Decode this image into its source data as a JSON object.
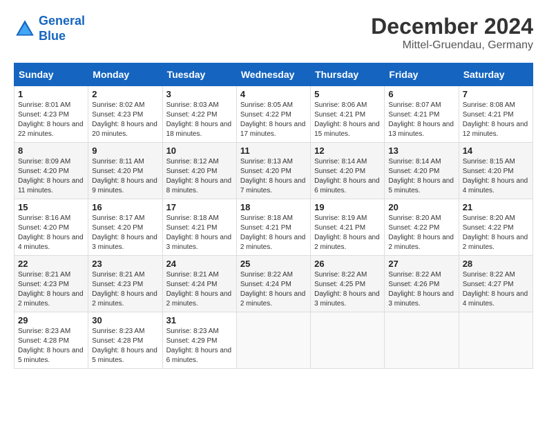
{
  "header": {
    "logo_line1": "General",
    "logo_line2": "Blue",
    "month_year": "December 2024",
    "location": "Mittel-Gruendau, Germany"
  },
  "calendar": {
    "days_of_week": [
      "Sunday",
      "Monday",
      "Tuesday",
      "Wednesday",
      "Thursday",
      "Friday",
      "Saturday"
    ],
    "weeks": [
      [
        {
          "day": "1",
          "info": "Sunrise: 8:01 AM\nSunset: 4:23 PM\nDaylight: 8 hours and 22 minutes."
        },
        {
          "day": "2",
          "info": "Sunrise: 8:02 AM\nSunset: 4:23 PM\nDaylight: 8 hours and 20 minutes."
        },
        {
          "day": "3",
          "info": "Sunrise: 8:03 AM\nSunset: 4:22 PM\nDaylight: 8 hours and 18 minutes."
        },
        {
          "day": "4",
          "info": "Sunrise: 8:05 AM\nSunset: 4:22 PM\nDaylight: 8 hours and 17 minutes."
        },
        {
          "day": "5",
          "info": "Sunrise: 8:06 AM\nSunset: 4:21 PM\nDaylight: 8 hours and 15 minutes."
        },
        {
          "day": "6",
          "info": "Sunrise: 8:07 AM\nSunset: 4:21 PM\nDaylight: 8 hours and 13 minutes."
        },
        {
          "day": "7",
          "info": "Sunrise: 8:08 AM\nSunset: 4:21 PM\nDaylight: 8 hours and 12 minutes."
        }
      ],
      [
        {
          "day": "8",
          "info": "Sunrise: 8:09 AM\nSunset: 4:20 PM\nDaylight: 8 hours and 11 minutes."
        },
        {
          "day": "9",
          "info": "Sunrise: 8:11 AM\nSunset: 4:20 PM\nDaylight: 8 hours and 9 minutes."
        },
        {
          "day": "10",
          "info": "Sunrise: 8:12 AM\nSunset: 4:20 PM\nDaylight: 8 hours and 8 minutes."
        },
        {
          "day": "11",
          "info": "Sunrise: 8:13 AM\nSunset: 4:20 PM\nDaylight: 8 hours and 7 minutes."
        },
        {
          "day": "12",
          "info": "Sunrise: 8:14 AM\nSunset: 4:20 PM\nDaylight: 8 hours and 6 minutes."
        },
        {
          "day": "13",
          "info": "Sunrise: 8:14 AM\nSunset: 4:20 PM\nDaylight: 8 hours and 5 minutes."
        },
        {
          "day": "14",
          "info": "Sunrise: 8:15 AM\nSunset: 4:20 PM\nDaylight: 8 hours and 4 minutes."
        }
      ],
      [
        {
          "day": "15",
          "info": "Sunrise: 8:16 AM\nSunset: 4:20 PM\nDaylight: 8 hours and 4 minutes."
        },
        {
          "day": "16",
          "info": "Sunrise: 8:17 AM\nSunset: 4:20 PM\nDaylight: 8 hours and 3 minutes."
        },
        {
          "day": "17",
          "info": "Sunrise: 8:18 AM\nSunset: 4:21 PM\nDaylight: 8 hours and 3 minutes."
        },
        {
          "day": "18",
          "info": "Sunrise: 8:18 AM\nSunset: 4:21 PM\nDaylight: 8 hours and 2 minutes."
        },
        {
          "day": "19",
          "info": "Sunrise: 8:19 AM\nSunset: 4:21 PM\nDaylight: 8 hours and 2 minutes."
        },
        {
          "day": "20",
          "info": "Sunrise: 8:20 AM\nSunset: 4:22 PM\nDaylight: 8 hours and 2 minutes."
        },
        {
          "day": "21",
          "info": "Sunrise: 8:20 AM\nSunset: 4:22 PM\nDaylight: 8 hours and 2 minutes."
        }
      ],
      [
        {
          "day": "22",
          "info": "Sunrise: 8:21 AM\nSunset: 4:23 PM\nDaylight: 8 hours and 2 minutes."
        },
        {
          "day": "23",
          "info": "Sunrise: 8:21 AM\nSunset: 4:23 PM\nDaylight: 8 hours and 2 minutes."
        },
        {
          "day": "24",
          "info": "Sunrise: 8:21 AM\nSunset: 4:24 PM\nDaylight: 8 hours and 2 minutes."
        },
        {
          "day": "25",
          "info": "Sunrise: 8:22 AM\nSunset: 4:24 PM\nDaylight: 8 hours and 2 minutes."
        },
        {
          "day": "26",
          "info": "Sunrise: 8:22 AM\nSunset: 4:25 PM\nDaylight: 8 hours and 3 minutes."
        },
        {
          "day": "27",
          "info": "Sunrise: 8:22 AM\nSunset: 4:26 PM\nDaylight: 8 hours and 3 minutes."
        },
        {
          "day": "28",
          "info": "Sunrise: 8:22 AM\nSunset: 4:27 PM\nDaylight: 8 hours and 4 minutes."
        }
      ],
      [
        {
          "day": "29",
          "info": "Sunrise: 8:23 AM\nSunset: 4:28 PM\nDaylight: 8 hours and 5 minutes."
        },
        {
          "day": "30",
          "info": "Sunrise: 8:23 AM\nSunset: 4:28 PM\nDaylight: 8 hours and 5 minutes."
        },
        {
          "day": "31",
          "info": "Sunrise: 8:23 AM\nSunset: 4:29 PM\nDaylight: 8 hours and 6 minutes."
        },
        {
          "day": "",
          "info": ""
        },
        {
          "day": "",
          "info": ""
        },
        {
          "day": "",
          "info": ""
        },
        {
          "day": "",
          "info": ""
        }
      ]
    ]
  }
}
